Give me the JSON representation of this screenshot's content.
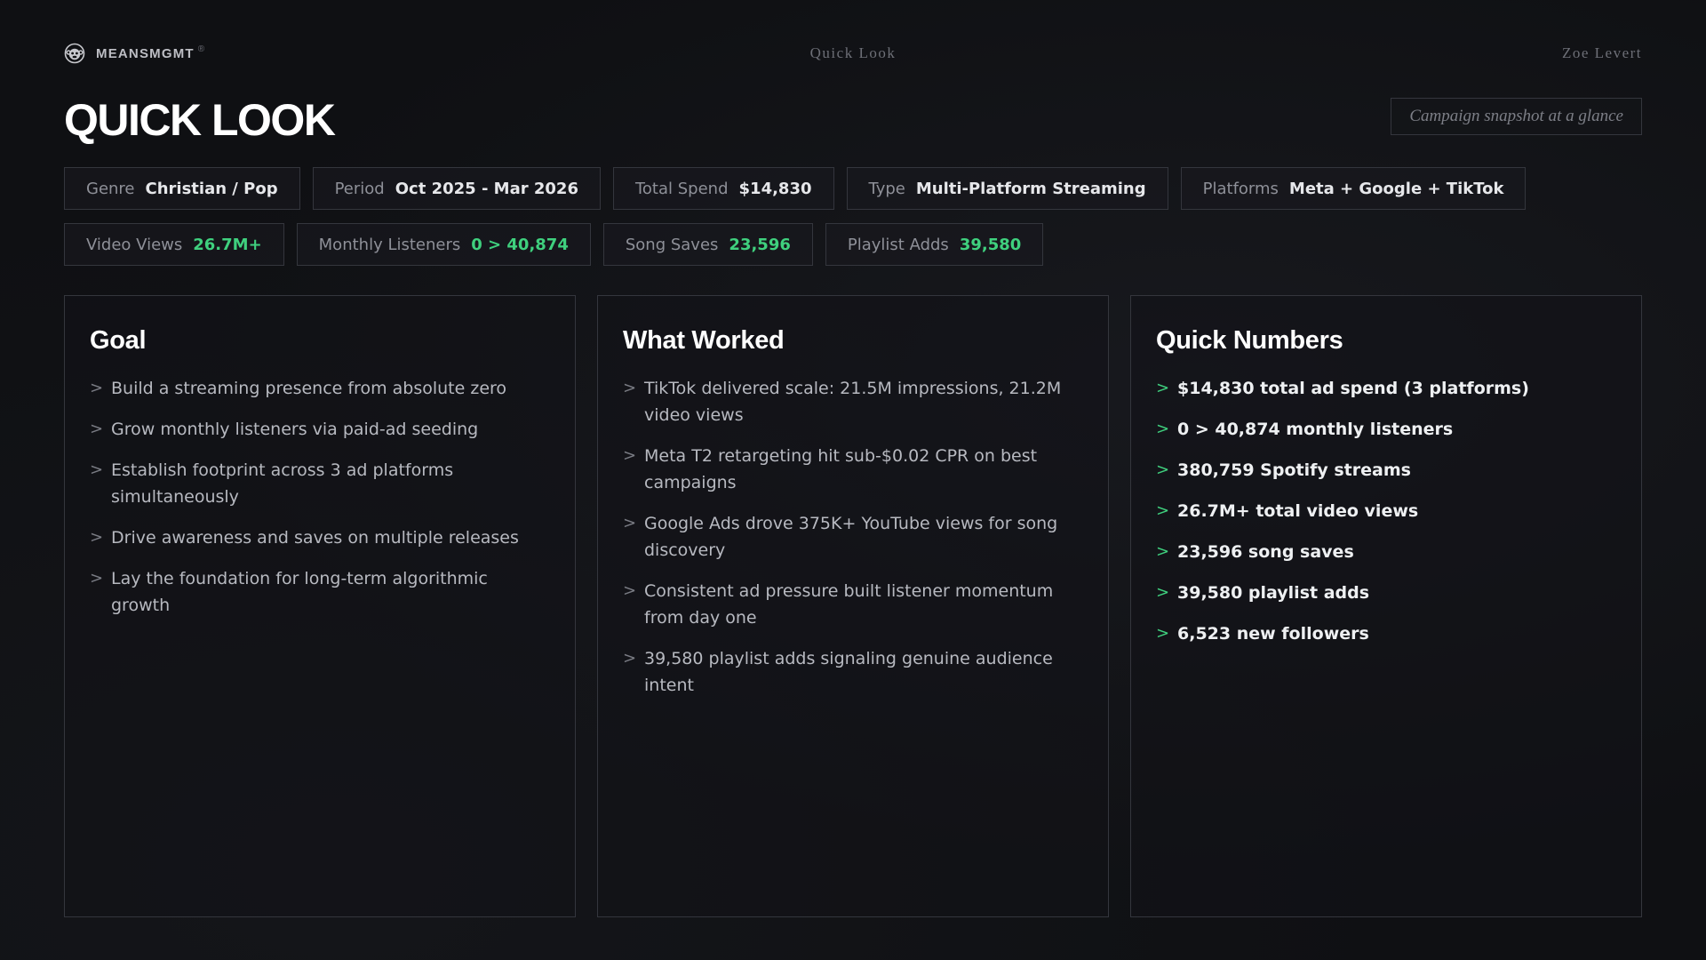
{
  "header": {
    "brand_name": "MEANSMGMT",
    "brand_reg": "®",
    "nav_center": "Quick Look",
    "nav_right": "Zoe Levert"
  },
  "page": {
    "title": "QUICK LOOK",
    "snapshot": "Campaign snapshot at a glance"
  },
  "chips_row1": [
    {
      "label": "Genre",
      "value": "Christian / Pop"
    },
    {
      "label": "Period",
      "value": "Oct 2025 - Mar 2026"
    },
    {
      "label": "Total Spend",
      "value": "$14,830"
    },
    {
      "label": "Type",
      "value": "Multi-Platform Streaming"
    },
    {
      "label": "Platforms",
      "value": "Meta + Google + TikTok"
    }
  ],
  "chips_row2": [
    {
      "label": "Video Views",
      "value": "26.7M+"
    },
    {
      "label": "Monthly Listeners",
      "value": "0 > 40,874"
    },
    {
      "label": "Song Saves",
      "value": "23,596"
    },
    {
      "label": "Playlist Adds",
      "value": "39,580"
    }
  ],
  "cards": {
    "goal": {
      "title": "Goal",
      "items": [
        "Build a streaming presence from absolute zero",
        "Grow monthly listeners via paid-ad seeding",
        "Establish footprint across 3 ad platforms simultaneously",
        "Drive awareness and saves on multiple releases",
        "Lay the foundation for long-term algorithmic growth"
      ]
    },
    "worked": {
      "title": "What Worked",
      "items": [
        "TikTok delivered scale: 21.5M impressions, 21.2M video views",
        "Meta T2 retargeting hit sub-$0.02 CPR on best campaigns",
        "Google Ads drove 375K+ YouTube views for song discovery",
        "Consistent ad pressure built listener momentum from day one",
        "39,580 playlist adds signaling genuine audience intent"
      ]
    },
    "numbers": {
      "title": "Quick Numbers",
      "items": [
        "$14,830 total ad spend (3 platforms)",
        "0 > 40,874 monthly listeners",
        "380,759 Spotify streams",
        "26.7M+ total video views",
        "23,596 song saves",
        "39,580 playlist adds",
        "6,523 new followers"
      ]
    }
  },
  "bullet_glyph": ">",
  "colors": {
    "accent_green": "#3fd07e",
    "background": "#0f1013",
    "border": "#34363d"
  },
  "icons": {
    "brand": "monkey-logo-icon",
    "bullet": "chevron-right-icon"
  }
}
